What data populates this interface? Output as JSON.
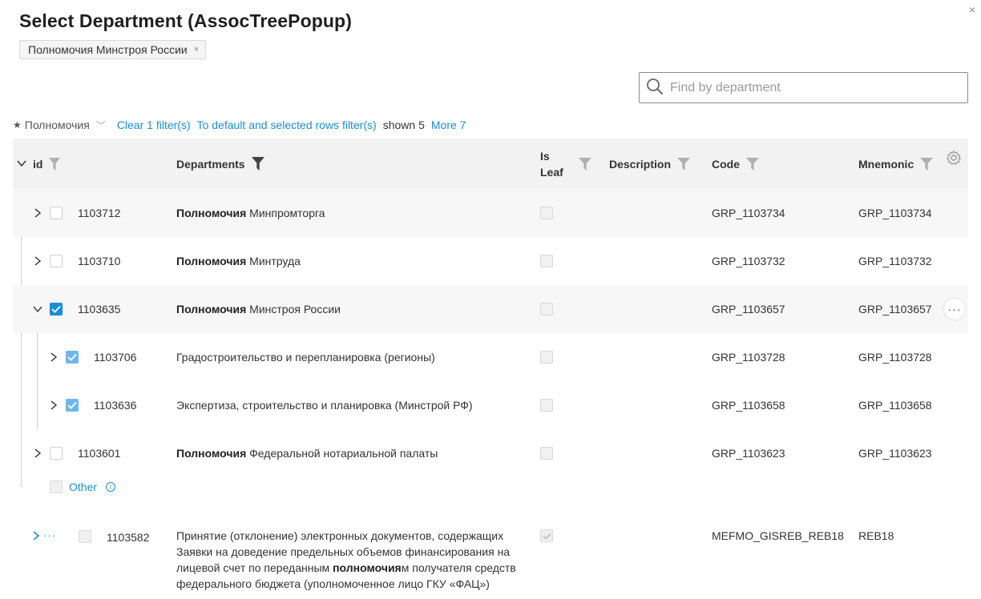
{
  "dialog": {
    "title": "Select Department (AssocTreePopup)",
    "close_glyph": "×",
    "chip": {
      "label": "Полномочия Минстроя России",
      "remove_glyph": "×"
    }
  },
  "search": {
    "placeholder": "Find by department",
    "value": ""
  },
  "filterbar": {
    "scope_label": "Полномочия",
    "clear_filters": "Clear 1 filter(s)",
    "default_filter": "To default and selected rows filter(s)",
    "shown": "shown 5",
    "more": "More 7"
  },
  "columns": {
    "id": "id",
    "departments": "Departments",
    "is_leaf_1": "Is",
    "is_leaf_2": "Leaf",
    "description": "Description",
    "code": "Code",
    "mnemonic": "Mnemonic"
  },
  "rows": [
    {
      "id": "1103712",
      "bold": "Полномочия",
      "name": " Минпромторга",
      "code": "GRP_1103734",
      "mnemonic": "GRP_1103734",
      "checked": false,
      "expanded": false
    },
    {
      "id": "1103710",
      "bold": "Полномочия",
      "name": " Минтруда",
      "code": "GRP_1103732",
      "mnemonic": "GRP_1103732",
      "checked": false,
      "expanded": false
    },
    {
      "id": "1103635",
      "bold": "Полномочия",
      "name": " Минстроя России",
      "code": "GRP_1103657",
      "mnemonic": "GRP_1103657",
      "checked": true,
      "expanded": true
    },
    {
      "id": "1103706",
      "bold": "",
      "name": "Градостроительство и перепланировка (регионы)",
      "code": "GRP_1103728",
      "mnemonic": "GRP_1103728",
      "checked": true,
      "expanded": false
    },
    {
      "id": "1103636",
      "bold": "",
      "name": "Экспертиза, строительство и планировка (Минстрой РФ)",
      "code": "GRP_1103658",
      "mnemonic": "GRP_1103658",
      "checked": true,
      "expanded": false
    },
    {
      "id": "1103601",
      "bold": "Полномочия",
      "name": " Федеральной нотариальной палаты",
      "code": "GRP_1103623",
      "mnemonic": "GRP_1103623",
      "checked": false,
      "expanded": false
    }
  ],
  "other": {
    "label": "Other",
    "info_glyph": "i"
  },
  "last_row": {
    "id": "1103582",
    "dots": "···",
    "text_before": "Принятие (отклонение) электронных документов, содержащих Заявки на доведение предельных объемов финансирования на лицевой счет по переданным ",
    "text_bold": "полномочия",
    "text_after": "м получателя средств федерального бюджета (уполномоченное лицо ГКУ «ФАЦ»)",
    "code": "MEFMO_GISREB_REB18",
    "mnemonic": "REB18"
  },
  "row_menu": {
    "dots": "···"
  },
  "colors": {
    "accent": "#1a8fd6",
    "header_bg": "#f2f2f2",
    "row_alt": "#f7f7f7"
  }
}
